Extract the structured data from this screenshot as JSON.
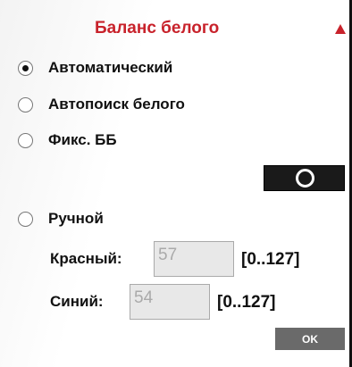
{
  "header": {
    "title": "Баланс белого",
    "collapse_icon": "triangle-up-icon",
    "accent_color": "#c8222b"
  },
  "options": [
    {
      "label": "Автоматический",
      "checked": true
    },
    {
      "label": "Автопоиск белого",
      "checked": false
    },
    {
      "label": "Фикс. ББ",
      "checked": false
    },
    {
      "label": "Ручной",
      "checked": false
    }
  ],
  "fixed_wb_button": {
    "icon": "record-circle-icon"
  },
  "manual": {
    "red": {
      "label": "Красный:",
      "value": "57",
      "range": "[0..127]"
    },
    "blue": {
      "label": "Синий:",
      "value": "54",
      "range": "[0..127]"
    }
  },
  "ok_button": {
    "label": "OK"
  }
}
